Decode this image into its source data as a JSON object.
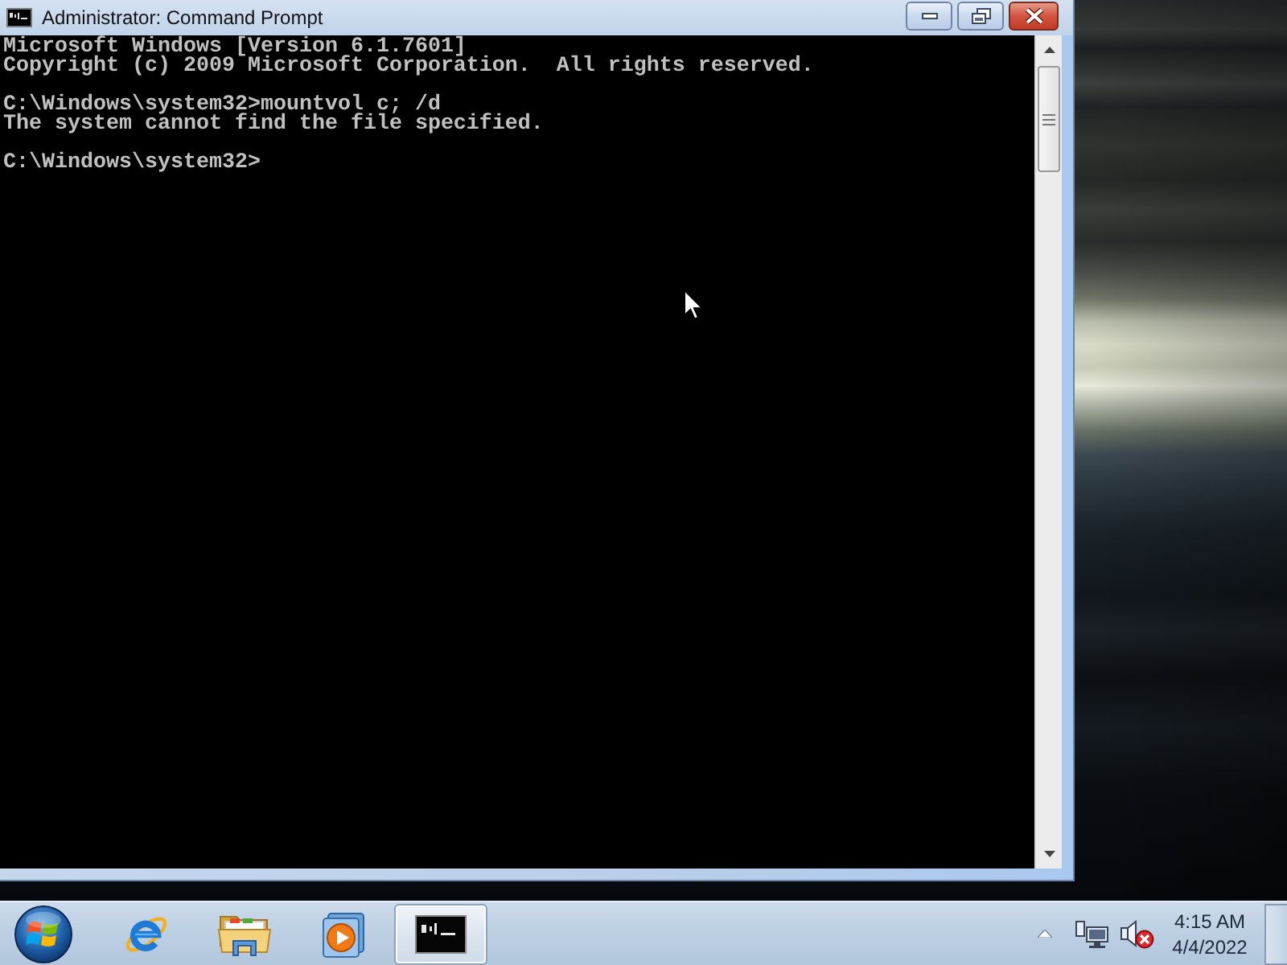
{
  "window": {
    "title": "Administrator: Command Prompt",
    "buttons": [
      {
        "kind": "minimize"
      },
      {
        "kind": "restore"
      },
      {
        "kind": "close"
      }
    ]
  },
  "console": {
    "blocks": [
      [
        "Microsoft Windows [Version 6.1.7601]",
        "Copyright (c) 2009 Microsoft Corporation.  All rights reserved."
      ],
      [
        "C:\\Windows\\system32>mountvol c; /d",
        "The system cannot find the file specified."
      ],
      [
        "C:\\Windows\\system32>"
      ]
    ]
  },
  "taskbar": {
    "items": [
      {
        "kind": "browser",
        "selected": false
      },
      {
        "kind": "folder",
        "selected": false
      },
      {
        "kind": "media",
        "selected": false
      },
      {
        "kind": "console",
        "selected": true
      }
    ]
  },
  "tray": {
    "volume": {
      "muted": true
    },
    "time": "4:15 AM",
    "date": "4/4/2022"
  }
}
